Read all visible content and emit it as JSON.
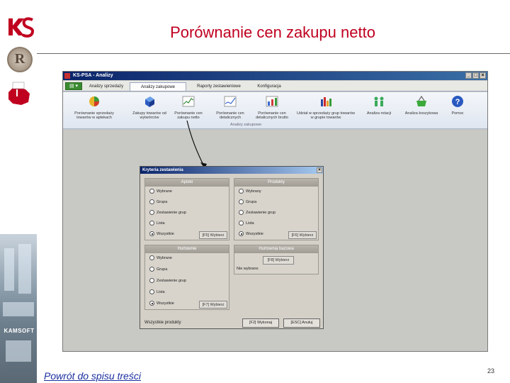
{
  "slide": {
    "title": "Porównanie cen zakupu netto",
    "back_link": "Powrót do spisu treści",
    "page_number": "23"
  },
  "branding": {
    "logo_ks": "KS",
    "logo_r": "R",
    "kamsoft": "KAMSOFT",
    "accent_color": "#c0001f"
  },
  "app": {
    "window_title": "KS-PSA - Analizy",
    "window_buttons": [
      "_",
      "□",
      "×"
    ],
    "menu_button": "▤ ▾",
    "tabs": [
      {
        "label": "Analizy sprzedaży",
        "active": false
      },
      {
        "label": "Analizy zakupowe",
        "active": true
      },
      {
        "label": "Raporty zestawieniowe",
        "active": false
      },
      {
        "label": "Konfiguracja",
        "active": false
      }
    ],
    "ribbon_buttons": [
      {
        "label": "Porównanie sprzedaży towarów w aptekach",
        "icon": "pie-chart-icon"
      },
      {
        "label": "Zakupy towarów od wytwórców",
        "icon": "cube-icon"
      },
      {
        "label": "Porównanie cen zakupu netto",
        "icon": "line-chart-icon"
      },
      {
        "label": "Porównanie cen detalicznych",
        "icon": "line-chart-icon"
      },
      {
        "label": "Porównanie cen detalicznych brutto",
        "icon": "bar-chart-icon"
      },
      {
        "label": "Udział w sprzedaży grup towarów w grupie towarów",
        "icon": "bar-chart-icon"
      },
      {
        "label": "Analiza rotacji",
        "icon": "people-icon"
      },
      {
        "label": "Analiza koszykowa",
        "icon": "basket-icon"
      },
      {
        "label": "Pomoc",
        "icon": "help-icon"
      }
    ],
    "ribbon_group": "Analizy zakupowe"
  },
  "dialog": {
    "title": "Kryteria zestawienia",
    "close": "×",
    "apteki": {
      "header": "Apteki",
      "options": [
        "Wybrane",
        "Grupa",
        "Zestawienie grup",
        "Lista",
        "Wszystkie"
      ],
      "selected": 4,
      "button": "[F5] Wybierz"
    },
    "produkty": {
      "header": "Produkty",
      "options": [
        "Wybrany",
        "Grupa",
        "Zestawienie grup",
        "Lista",
        "Wszystkie"
      ],
      "selected": 4,
      "button": "[F6] Wybierz"
    },
    "hurtownie": {
      "header": "Hurtownie",
      "options": [
        "Wybrane",
        "Grupa",
        "Zestawienie grup",
        "Lista",
        "Wszystkie"
      ],
      "selected": 4,
      "button": "[F7] Wybierz"
    },
    "hurtownia_bazowa": {
      "header": "Hurtownia bazowa",
      "button": "[F8] Wybierz",
      "value": "Nie wybrano"
    },
    "footer_label": "Wszystkie produkty",
    "ok_button": "[F2] Wykonaj",
    "cancel_button": "[ESC] Anuluj"
  }
}
